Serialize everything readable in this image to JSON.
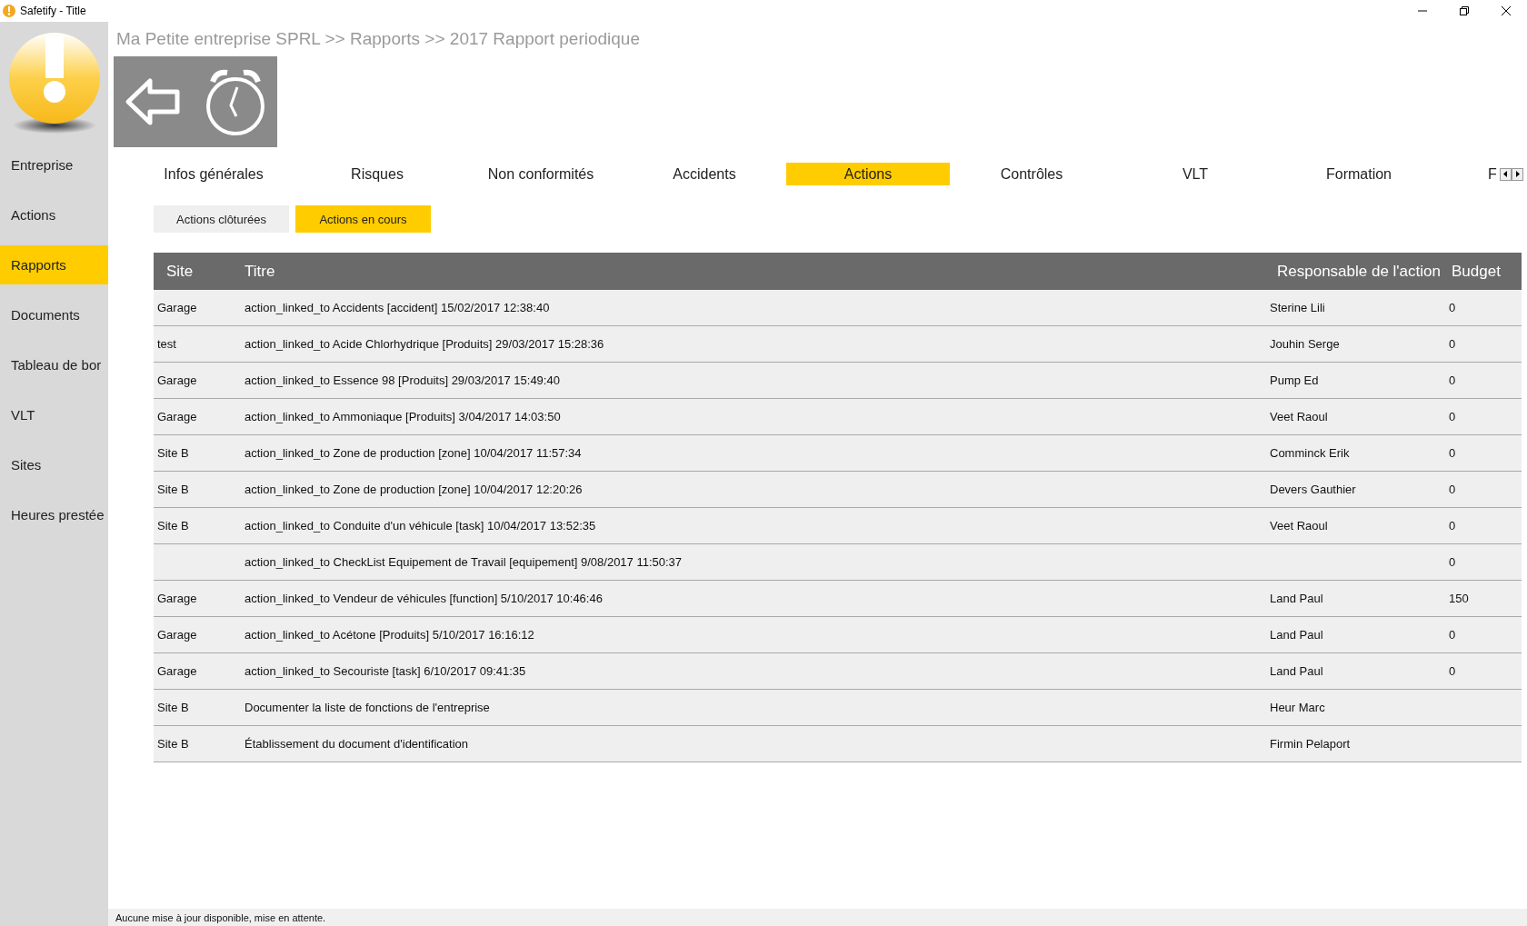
{
  "window": {
    "title": "Safetify - Title"
  },
  "breadcrumb": "Ma Petite entreprise SPRL >> Rapports >> 2017 Rapport periodique",
  "sidebar": {
    "items": [
      {
        "label": "Entreprise",
        "selected": false
      },
      {
        "label": "Actions",
        "selected": false
      },
      {
        "label": "Rapports",
        "selected": true
      },
      {
        "label": "Documents",
        "selected": false
      },
      {
        "label": "Tableau de bor",
        "selected": false
      },
      {
        "label": "VLT",
        "selected": false
      },
      {
        "label": "Sites",
        "selected": false
      },
      {
        "label": "Heures prestée",
        "selected": false
      }
    ]
  },
  "tabs": [
    {
      "label": "Infos générales",
      "selected": false
    },
    {
      "label": "Risques",
      "selected": false
    },
    {
      "label": "Non conformités",
      "selected": false
    },
    {
      "label": "Accidents",
      "selected": false
    },
    {
      "label": "Actions",
      "selected": true
    },
    {
      "label": "Contrôles",
      "selected": false
    },
    {
      "label": "VLT",
      "selected": false
    },
    {
      "label": "Formation",
      "selected": false
    },
    {
      "label": "F",
      "selected": false
    }
  ],
  "subtabs": [
    {
      "label": "Actions clôturées",
      "selected": false
    },
    {
      "label": "Actions en cours",
      "selected": true
    }
  ],
  "table": {
    "columns": [
      "Site",
      "Titre",
      "Responsable de l'action",
      "Budget"
    ],
    "rows": [
      [
        "Garage",
        "action_linked_to Accidents [accident]  15/02/2017 12:38:40",
        "Sterine Lili",
        "0"
      ],
      [
        "test",
        "action_linked_to Acide Chlorhydrique [Produits]  29/03/2017 15:28:36",
        "Jouhin Serge",
        "0"
      ],
      [
        "Garage",
        "action_linked_to Essence 98 [Produits]  29/03/2017 15:49:40",
        "Pump Ed",
        "0"
      ],
      [
        "Garage",
        "action_linked_to Ammoniaque [Produits]  3/04/2017 14:03:50",
        "Veet Raoul",
        "0"
      ],
      [
        "Site B",
        "action_linked_to Zone de production [zone]  10/04/2017 11:57:34",
        "Comminck Erik",
        "0"
      ],
      [
        "Site B",
        "action_linked_to Zone de production [zone]  10/04/2017 12:20:26",
        "Devers Gauthier",
        "0"
      ],
      [
        "Site B",
        "action_linked_to Conduite d'un véhicule [task]  10/04/2017 13:52:35",
        "Veet Raoul",
        "0"
      ],
      [
        "",
        "action_linked_to CheckList Equipement de Travail  [equipement]  9/08/2017 11:50:37",
        "",
        "0"
      ],
      [
        "Garage",
        "action_linked_to Vendeur de véhicules [function]  5/10/2017 10:46:46",
        "Land Paul",
        "150"
      ],
      [
        "Garage",
        "action_linked_to Acétone [Produits]  5/10/2017 16:16:12",
        "Land Paul",
        "0"
      ],
      [
        "Garage",
        "action_linked_to Secouriste [task]  6/10/2017 09:41:35",
        "Land Paul",
        "0"
      ],
      [
        "Site B",
        "Documenter la liste de fonctions de l'entreprise",
        "Heur Marc",
        ""
      ],
      [
        "Site B",
        "Établissement du document d'identification",
        "Firmin Pelaport",
        ""
      ]
    ]
  },
  "status_bar": "Aucune mise à jour disponible, mise en attente."
}
